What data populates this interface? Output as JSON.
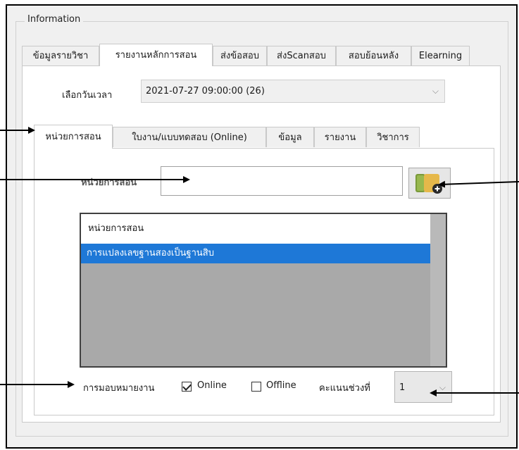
{
  "group_title": "Information",
  "top_tabs": [
    {
      "label": "ข้อมูลรายวิชา",
      "active": false
    },
    {
      "label": "รายงานหลักการสอน",
      "active": true
    },
    {
      "label": "ส่งข้อสอบ",
      "active": false
    },
    {
      "label": "ส่งScanสอบ",
      "active": false
    },
    {
      "label": "สอบย้อนหลัง",
      "active": false
    },
    {
      "label": "Elearning",
      "active": false
    }
  ],
  "date_selector": {
    "label": "เลือกวันเวลา",
    "value": "2021-07-27 09:00:00 (26)"
  },
  "inner_tabs": [
    {
      "label": "หน่วยการสอน",
      "active": true
    },
    {
      "label": "ใบงาน/แบบทดสอบ (Online)",
      "active": false
    },
    {
      "label": "ข้อมูล",
      "active": false
    },
    {
      "label": "รายงาน",
      "active": false
    },
    {
      "label": "วิชาการ",
      "active": false
    }
  ],
  "unit": {
    "label": "หน่วยการสอน",
    "input_value": ""
  },
  "unit_list": {
    "header": "หน่วยการสอน",
    "selected_item": "การแปลงเลขฐานสองเป็นฐานสิบ"
  },
  "assignment": {
    "label": "การมอบหมายงาน",
    "online_label": "Online",
    "online_checked": true,
    "offline_label": "Offline",
    "offline_checked": false
  },
  "score": {
    "label": "คะแนนช่วงที่",
    "value": "1"
  },
  "colors": {
    "selection": "#1e78d7",
    "window_bg": "#f0f0f0",
    "list_bg": "#a9a9a9"
  }
}
